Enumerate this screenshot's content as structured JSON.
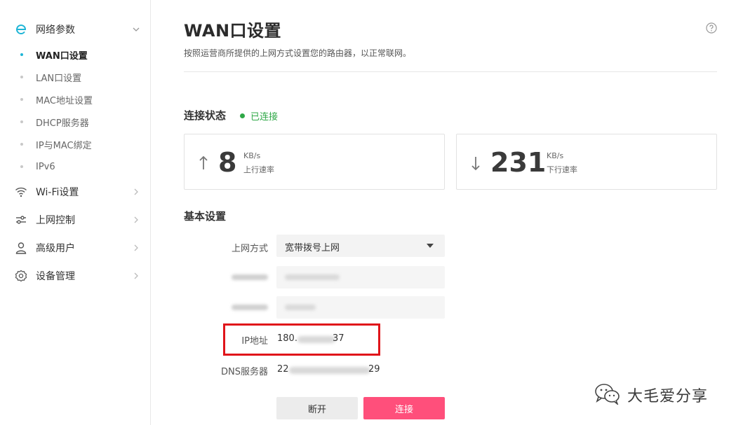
{
  "sidebar": {
    "groups": [
      {
        "label": "网络参数",
        "icon": "brand-e-icon",
        "expanded": true
      },
      {
        "label": "Wi-Fi设置",
        "icon": "wifi-icon"
      },
      {
        "label": "上网控制",
        "icon": "sliders-icon"
      },
      {
        "label": "高级用户",
        "icon": "user-icon"
      },
      {
        "label": "设备管理",
        "icon": "gear-icon"
      }
    ],
    "sub_items": [
      {
        "label": "WAN口设置",
        "active": true
      },
      {
        "label": "LAN口设置"
      },
      {
        "label": "MAC地址设置"
      },
      {
        "label": "DHCP服务器"
      },
      {
        "label": "IP与MAC绑定"
      },
      {
        "label": "IPv6"
      }
    ]
  },
  "header": {
    "title": "WAN口设置",
    "subtitle": "按照运营商所提供的上网方式设置您的路由器，以正常联网。",
    "help_icon": "question-circle-icon"
  },
  "connection": {
    "section_title": "连接状态",
    "status_text": "已连接",
    "status_color": "#2fa847",
    "upload": {
      "value": "8",
      "unit": "KB/s",
      "caption": "上行速率"
    },
    "download": {
      "value": "231",
      "unit": "KB/s",
      "caption": "下行速率"
    }
  },
  "basic": {
    "section_title": "基本设置",
    "mode_label": "上网方式",
    "mode_value": "宽带拨号上网",
    "ip_label": "IP地址",
    "ip_prefix": "180.",
    "ip_suffix": "37",
    "dns_label": "DNS服务器",
    "dns_prefix": "22",
    "dns_suffix": "29"
  },
  "buttons": {
    "disconnect": "断开",
    "connect": "连接"
  },
  "colors": {
    "accent": "#1fb5d6",
    "primary_button": "#ff4f7b",
    "highlight_box": "#e0141a"
  },
  "watermark": {
    "text": "大毛爱分享",
    "icon": "wechat-icon"
  }
}
